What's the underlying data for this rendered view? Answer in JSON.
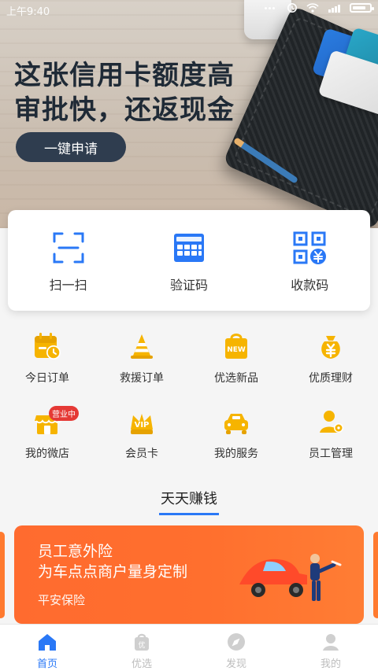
{
  "status_bar": {
    "time": "上午9:40",
    "icons": [
      "dots-icon",
      "alarm-icon",
      "wifi-icon",
      "signal-icon",
      "battery-icon"
    ]
  },
  "banner": {
    "title_line1": "这张信用卡额度高",
    "title_line2": "审批快，还返现金",
    "apply_button": "一键申请",
    "colors": {
      "apply_bg": "#2f3d4f"
    }
  },
  "quick_actions": [
    {
      "id": "scan",
      "label": "扫一扫",
      "icon": "scan-icon"
    },
    {
      "id": "verify",
      "label": "验证码",
      "icon": "keypad-icon"
    },
    {
      "id": "receive",
      "label": "收款码",
      "icon": "qr-yen-icon"
    }
  ],
  "services": [
    {
      "id": "today_orders",
      "label": "今日订单",
      "icon": "calendar-clock-icon"
    },
    {
      "id": "rescue_orders",
      "label": "救援订单",
      "icon": "traffic-cone-icon"
    },
    {
      "id": "new_products",
      "label": "优选新品",
      "icon": "new-bag-icon"
    },
    {
      "id": "finance",
      "label": "优质理财",
      "icon": "money-bag-icon"
    },
    {
      "id": "my_store",
      "label": "我的微店",
      "icon": "store-icon",
      "badge": "营业中"
    },
    {
      "id": "vip_card",
      "label": "会员卡",
      "icon": "vip-crown-icon"
    },
    {
      "id": "my_service",
      "label": "我的服务",
      "icon": "car-icon"
    },
    {
      "id": "staff_mgmt",
      "label": "员工管理",
      "icon": "staff-settings-icon"
    }
  ],
  "section": {
    "title": "天天赚钱"
  },
  "promo": {
    "line1": "员工意外险",
    "line2": "为车点点商户量身定制",
    "footer": "平安保险"
  },
  "tabbar": [
    {
      "id": "home",
      "label": "首页",
      "icon": "home-icon",
      "active": true
    },
    {
      "id": "select",
      "label": "优选",
      "icon": "select-bag-icon",
      "active": false
    },
    {
      "id": "discover",
      "label": "发现",
      "icon": "compass-icon",
      "active": false
    },
    {
      "id": "mine",
      "label": "我的",
      "icon": "user-icon",
      "active": false
    }
  ],
  "theme": {
    "primary_blue": "#2a78f6",
    "icon_yellow": "#f6b400",
    "promo_orange": "#ff6b2f"
  }
}
